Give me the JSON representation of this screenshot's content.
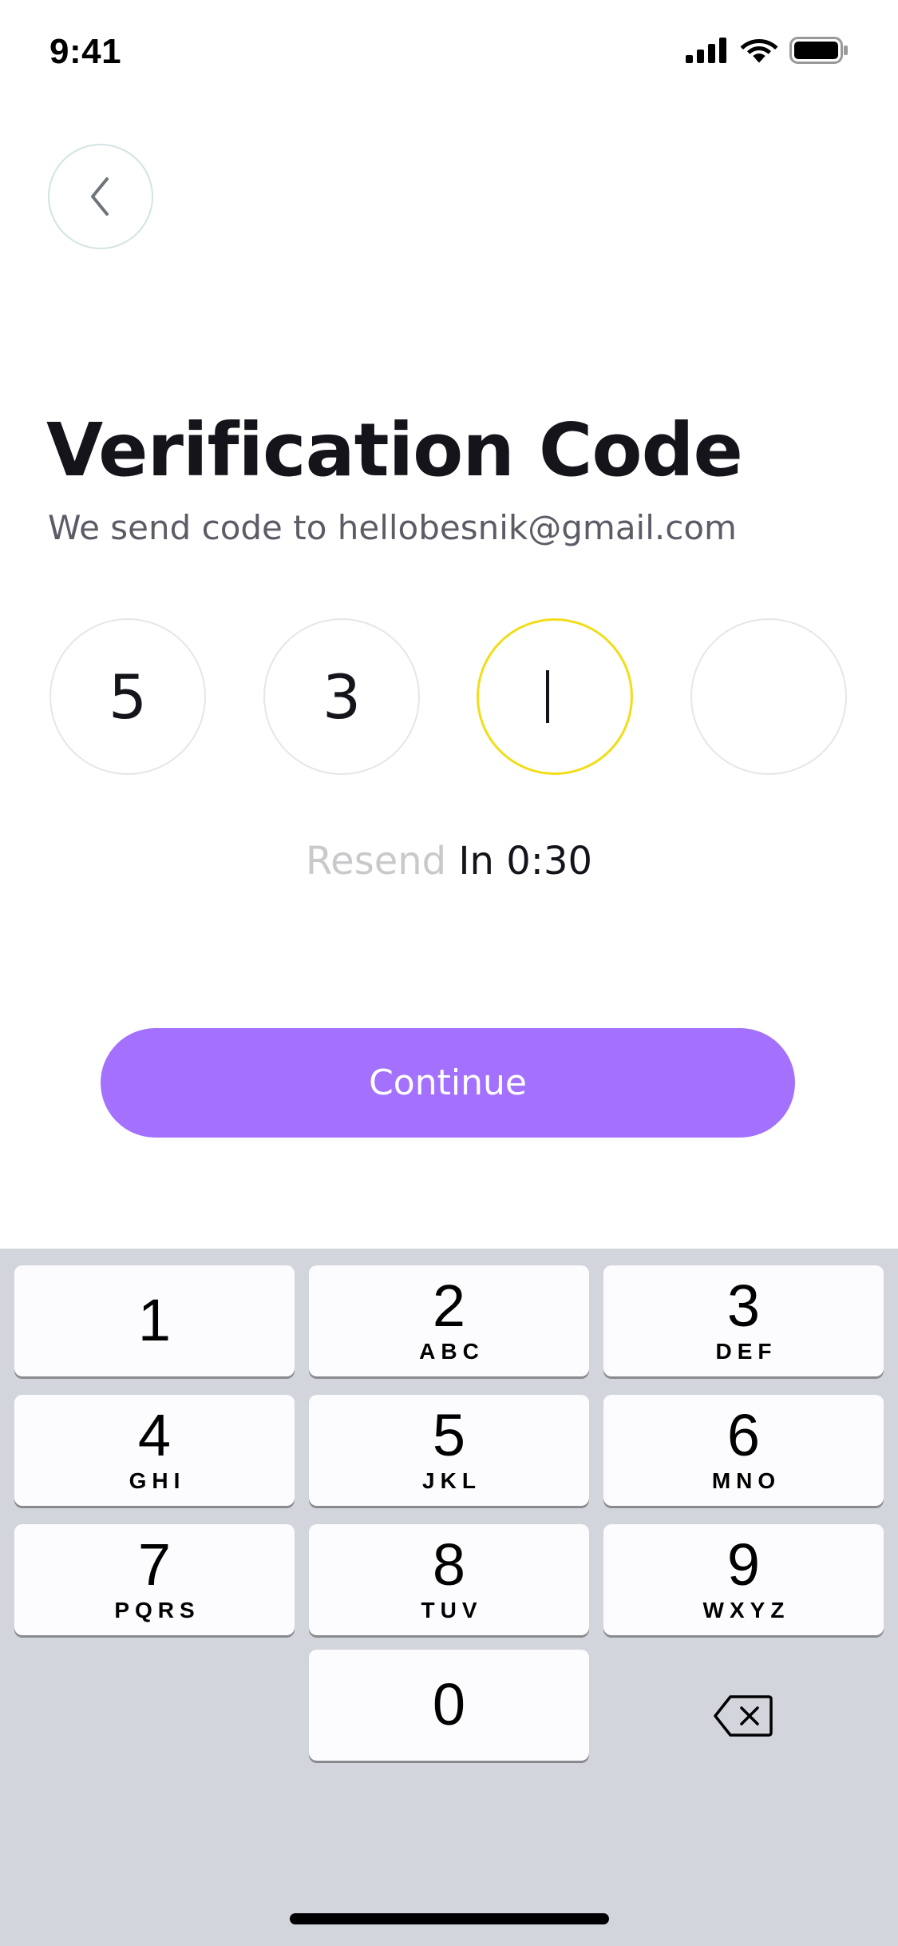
{
  "status_bar": {
    "time": "9:41",
    "icons": [
      "signal-icon",
      "wifi-icon",
      "battery-icon"
    ]
  },
  "back_button": {
    "icon": "chevron-left-icon"
  },
  "header": {
    "title": "Verification Code",
    "subtitle": "We send code to hellobesnik@gmail.com"
  },
  "code": {
    "digits": [
      "5",
      "3",
      "",
      ""
    ],
    "active_index": 2
  },
  "resend": {
    "label": "Resend",
    "timer": "In 0:30"
  },
  "continue_button": {
    "label": "Continue",
    "color": "#A371FE"
  },
  "colors": {
    "accent": "#A371FE",
    "active_box_border": "#F2DD1B",
    "keyboard_bg": "#D2D5DB"
  },
  "keyboard": {
    "keys": [
      {
        "digit": "1",
        "letters": ""
      },
      {
        "digit": "2",
        "letters": "ABC"
      },
      {
        "digit": "3",
        "letters": "DEF"
      },
      {
        "digit": "4",
        "letters": "GHI"
      },
      {
        "digit": "5",
        "letters": "JKL"
      },
      {
        "digit": "6",
        "letters": "MNO"
      },
      {
        "digit": "7",
        "letters": "PQRS"
      },
      {
        "digit": "8",
        "letters": "TUV"
      },
      {
        "digit": "9",
        "letters": "WXYZ"
      },
      {
        "digit": "0",
        "letters": ""
      }
    ],
    "delete_icon": "backspace-icon"
  }
}
